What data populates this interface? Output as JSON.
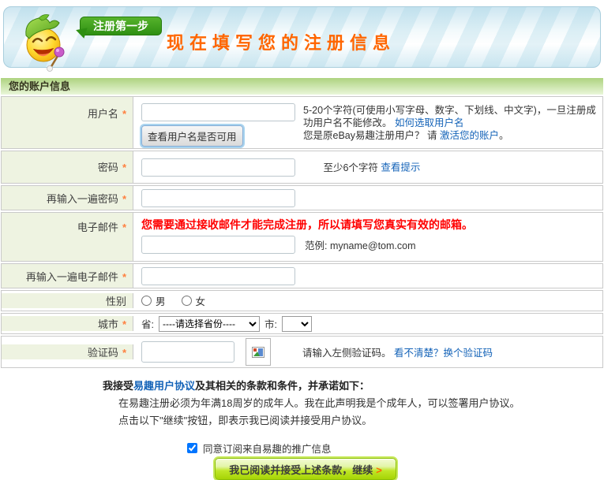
{
  "header": {
    "badge": "注册第一步",
    "title": "现在填写您的注册信息"
  },
  "section": {
    "title": "您的账户信息"
  },
  "form": {
    "username": {
      "label": "用户名",
      "required": "*",
      "input_value": "",
      "check_button": "查看用户名是否可用",
      "help_text": "5-20个字符(可使用小写字母、数字、下划线、中文字)，一旦注册成功用户名不能修改。",
      "help_link": "如何选取用户名",
      "ebay_prefix": "您是原eBay易趣注册用户？ 请 ",
      "ebay_link": "激活您的账户",
      "ebay_suffix": "。"
    },
    "password": {
      "label": "密码",
      "required": "*",
      "input_value": "",
      "hint": "至少6个字符",
      "hint_link": "查看提示"
    },
    "password_confirm": {
      "label": "再输入一遍密码",
      "required": "*",
      "input_value": ""
    },
    "email": {
      "label": "电子邮件",
      "required": "*",
      "input_value": "",
      "warning": "您需要通过接收邮件才能完成注册，所以请填写您真实有效的邮箱。",
      "example": "范例: myname@tom.com"
    },
    "email_confirm": {
      "label": "再输入一遍电子邮件",
      "required": "*",
      "input_value": ""
    },
    "gender": {
      "label": "性别",
      "male": "男",
      "female": "女"
    },
    "city": {
      "label": "城市",
      "required": "*",
      "province_label": "省:",
      "province_selected": "----请选择省份----",
      "city_label": "市:",
      "city_selected": ""
    },
    "captcha": {
      "label": "验证码",
      "required": "*",
      "input_value": "",
      "hint": "请输入左侧验证码。",
      "refresh_link": "看不清楚？换个验证码"
    }
  },
  "agreement": {
    "line1_prefix": "我接受",
    "line1_link": "易趣用户协议",
    "line1_suffix": "及其相关的条款和条件，并承诺如下：",
    "line2": "在易趣注册必须为年满18周岁的成年人。我在此声明我是个成年人，可以签署用户协议。",
    "line3": "点击以下\"继续\"按钮，即表示我已阅读并接受用户协议。",
    "subscribe_label": "同意订阅来自易趣的推广信息",
    "subscribe_checked": "checked",
    "continue_label": "我已阅读并接受上述条款，继续",
    "continue_arrow": ">"
  },
  "colors": {
    "title_orange": "#ff6600",
    "link_blue": "#1463b8",
    "warning_red": "#ff0000",
    "section_green": "#aed37f",
    "button_lime": "#b5e014",
    "label_bg": "#eef3e1"
  }
}
